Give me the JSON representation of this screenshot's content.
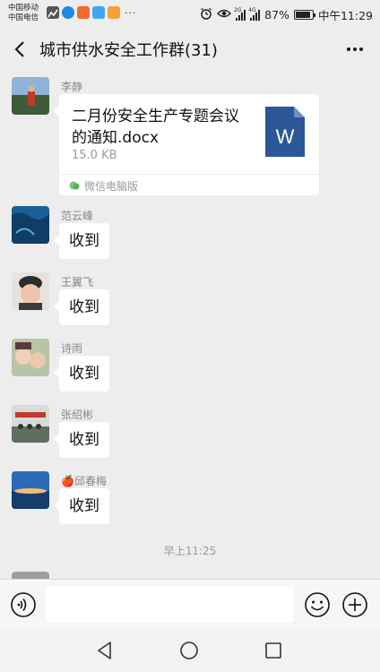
{
  "status_bar": {
    "carrier_1": "中国移动",
    "carrier_2": "中国电信",
    "app_icon_colors": [
      "#2f7de1",
      "#e8503a",
      "#f0a030",
      "#3fa7f0",
      "#f0a030"
    ],
    "more_dots": "···",
    "signal_1": "2G",
    "signal_2": "4G",
    "battery_level": 0.87,
    "battery_percent": "87%",
    "time": "中午11:29"
  },
  "header": {
    "title": "城市供水安全工作群(31)"
  },
  "messages": [
    {
      "sender": "李静",
      "type": "file",
      "file_name": "二月份安全生产专题会议的通知.docx",
      "file_size": "15.0 KB",
      "file_icon_letter": "W",
      "source": "微信电脑版",
      "avatar_colors": [
        "#6f9fd0",
        "#3a5a3a"
      ]
    },
    {
      "sender": "范云峰",
      "type": "text",
      "text": "收到",
      "avatar_colors": [
        "#1d6fa8",
        "#0b3b6a"
      ]
    },
    {
      "sender": "王翼飞",
      "type": "text",
      "text": "收到",
      "avatar_colors": [
        "#e8b89c",
        "#3a3a3a"
      ]
    },
    {
      "sender": "诗雨",
      "type": "text",
      "text": "收到",
      "avatar_colors": [
        "#c8b8a0",
        "#8a6a5a"
      ]
    },
    {
      "sender": "张绍彬",
      "type": "text",
      "text": "收到",
      "avatar_colors": [
        "#dcdcdc",
        "#5a6a5a"
      ]
    },
    {
      "sender": "🍎邱春梅",
      "type": "text",
      "text": "收到",
      "avatar_colors": [
        "#2a6ab8",
        "#f0c070"
      ]
    }
  ],
  "timestamp": "早上11:25",
  "input": {
    "placeholder": ""
  },
  "colors": {
    "background": "#ededed",
    "bubble": "#ffffff",
    "word_blue": "#2b5797"
  }
}
